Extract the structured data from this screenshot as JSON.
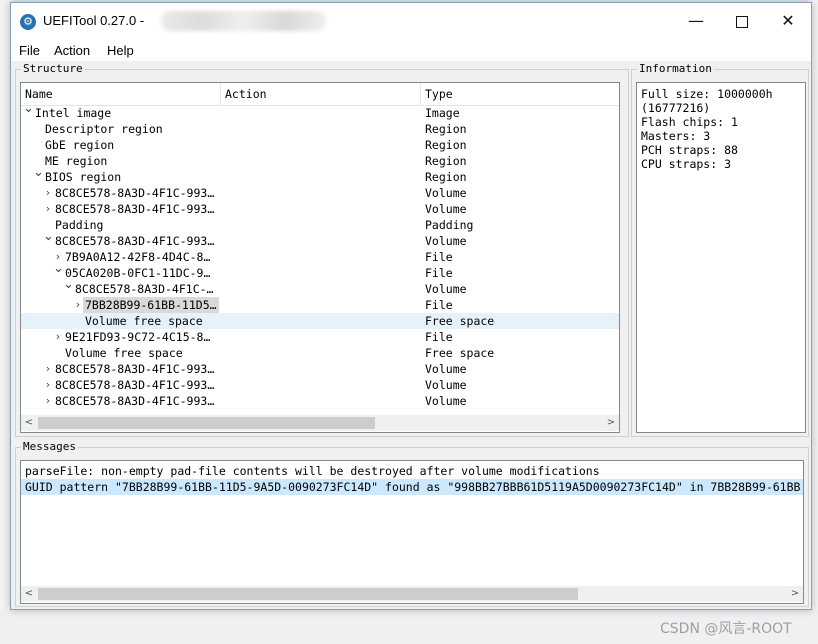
{
  "window": {
    "title": "UEFITool 0.27.0 - ",
    "minimize": "—",
    "close": "✕"
  },
  "menu": [
    "File",
    "Action",
    "Help"
  ],
  "structure": {
    "label": "Structure",
    "columns": [
      "Name",
      "Action",
      "Type"
    ],
    "rows": [
      {
        "name": "Intel image",
        "type": "Image",
        "depth": 0,
        "exp": "v"
      },
      {
        "name": "Descriptor region",
        "type": "Region",
        "depth": 1,
        "exp": ""
      },
      {
        "name": "GbE region",
        "type": "Region",
        "depth": 1,
        "exp": ""
      },
      {
        "name": "ME region",
        "type": "Region",
        "depth": 1,
        "exp": ""
      },
      {
        "name": "BIOS region",
        "type": "Region",
        "depth": 1,
        "exp": "v"
      },
      {
        "name": "8C8CE578-8A3D-4F1C-993…",
        "type": "Volume",
        "depth": 2,
        "exp": ">"
      },
      {
        "name": "8C8CE578-8A3D-4F1C-993…",
        "type": "Volume",
        "depth": 2,
        "exp": ">"
      },
      {
        "name": "Padding",
        "type": "Padding",
        "depth": 2,
        "exp": ""
      },
      {
        "name": "8C8CE578-8A3D-4F1C-993…",
        "type": "Volume",
        "depth": 2,
        "exp": "v"
      },
      {
        "name": "7B9A0A12-42F8-4D4C-8…",
        "type": "File",
        "depth": 3,
        "exp": ">"
      },
      {
        "name": "05CA020B-0FC1-11DC-9…",
        "type": "File",
        "depth": 3,
        "exp": "v"
      },
      {
        "name": "8C8CE578-8A3D-4F1C-…",
        "type": "Volume",
        "depth": 4,
        "exp": "v"
      },
      {
        "name": "7BB28B99-61BB-11D5…",
        "type": "File",
        "depth": 5,
        "exp": ">",
        "highlight": true
      },
      {
        "name": "Volume free space",
        "type": "Free space",
        "depth": 5,
        "exp": "",
        "selected": true
      },
      {
        "name": "9E21FD93-9C72-4C15-8…",
        "type": "File",
        "depth": 3,
        "exp": ">"
      },
      {
        "name": "Volume free space",
        "type": "Free space",
        "depth": 3,
        "exp": ""
      },
      {
        "name": "8C8CE578-8A3D-4F1C-993…",
        "type": "Volume",
        "depth": 2,
        "exp": ">"
      },
      {
        "name": "8C8CE578-8A3D-4F1C-993…",
        "type": "Volume",
        "depth": 2,
        "exp": ">"
      },
      {
        "name": "8C8CE578-8A3D-4F1C-993…",
        "type": "Volume",
        "depth": 2,
        "exp": ">"
      }
    ]
  },
  "information": {
    "label": "Information",
    "text": "Full size: 1000000h\n(16777216)\nFlash chips: 1\nMasters: 3\nPCH straps: 88\nCPU straps: 3"
  },
  "messages": {
    "label": "Messages",
    "lines": [
      "parseFile: non-empty pad-file contents will be destroyed after volume modifications",
      "GUID pattern \"7BB28B99-61BB-11D5-9A5D-0090273FC14D\" found as \"998BB27BBB61D5119A5D0090273FC14D\" in 7BB28B99-61BB"
    ]
  },
  "watermark": "CSDN @风言-ROOT",
  "scroll": {
    "left": "<",
    "right": ">"
  }
}
